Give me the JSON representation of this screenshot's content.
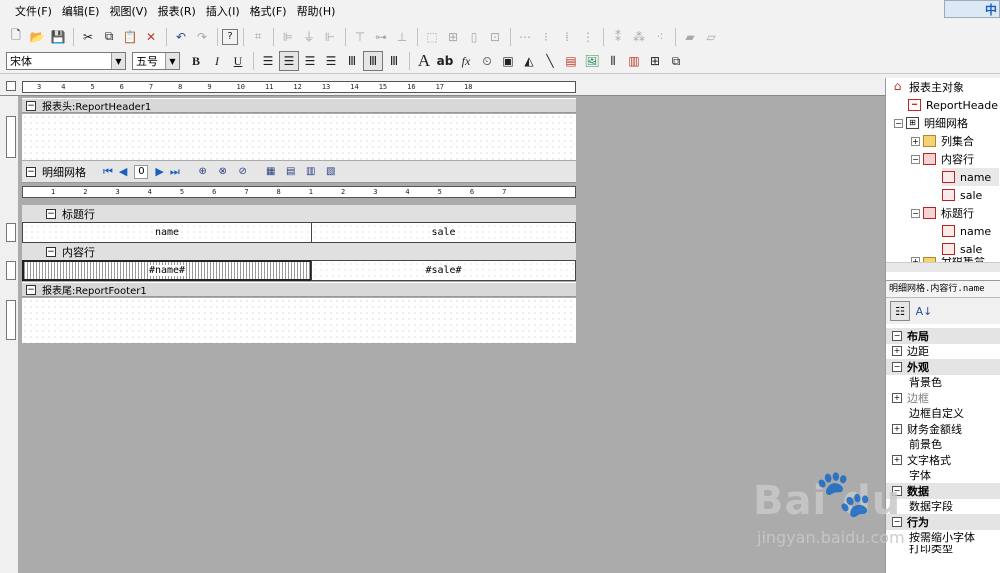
{
  "menubar": {
    "items": [
      "文件(F)",
      "编辑(E)",
      "视图(V)",
      "报表(R)",
      "插入(I)",
      "格式(F)",
      "帮助(H)"
    ],
    "ime_indicator": "中"
  },
  "toolbar": {
    "font_name": "宋体",
    "font_size": "五号",
    "bold": "B",
    "italic": "I",
    "underline": "U",
    "text_tool": "A",
    "label_tool": "ab",
    "function_tool": "fx"
  },
  "ruler": {
    "top_marks": [
      "3",
      "4",
      "5",
      "6",
      "7",
      "8",
      "9",
      "10",
      "11",
      "12",
      "13",
      "14",
      "15",
      "16",
      "17",
      "18"
    ],
    "grid_marks": [
      "1",
      "2",
      "3",
      "4",
      "5",
      "6",
      "7",
      "8",
      "1",
      "2",
      "3",
      "4",
      "5",
      "6",
      "7"
    ]
  },
  "designer": {
    "report_header": "报表头:ReportHeader1",
    "detail_grid": "明细网格",
    "pager_value": "0",
    "title_row": "标题行",
    "content_row": "内容行",
    "report_footer": "报表尾:ReportFooter1",
    "title_cells": [
      "name",
      "sale"
    ],
    "content_cells": [
      "#name#",
      "#sale#"
    ]
  },
  "tree": {
    "root": "报表主对象",
    "report_header": "ReportHeade",
    "detail_grid": "明细网格",
    "column_set": "列集合",
    "content_row": "内容行",
    "content_name": "name",
    "content_sale": "sale",
    "title_row": "标题行",
    "title_name": "name",
    "title_sale": "sale",
    "group_set": "分组集合"
  },
  "properties": {
    "path": "明细网格.内容行.name",
    "rows": [
      {
        "label": "布局",
        "kind": "category"
      },
      {
        "label": "边距",
        "kind": "expandable"
      },
      {
        "label": "外观",
        "kind": "category"
      },
      {
        "label": "背景色",
        "kind": "item"
      },
      {
        "label": "边框",
        "kind": "expandable-gray"
      },
      {
        "label": "边框自定义",
        "kind": "item"
      },
      {
        "label": "财务金额线",
        "kind": "expandable"
      },
      {
        "label": "前景色",
        "kind": "item"
      },
      {
        "label": "文字格式",
        "kind": "expandable"
      },
      {
        "label": "字体",
        "kind": "item"
      },
      {
        "label": "数据",
        "kind": "category"
      },
      {
        "label": "数据字段",
        "kind": "item"
      },
      {
        "label": "行为",
        "kind": "category"
      },
      {
        "label": "按需缩小字体",
        "kind": "item"
      },
      {
        "label": "打印类型",
        "kind": "item"
      }
    ]
  },
  "watermark": {
    "brand": "Bai du",
    "url": "jingyan.baidu.com"
  },
  "colors": {
    "canvas_bg": "#ababab",
    "accent_blue": "#1b5fc0"
  }
}
